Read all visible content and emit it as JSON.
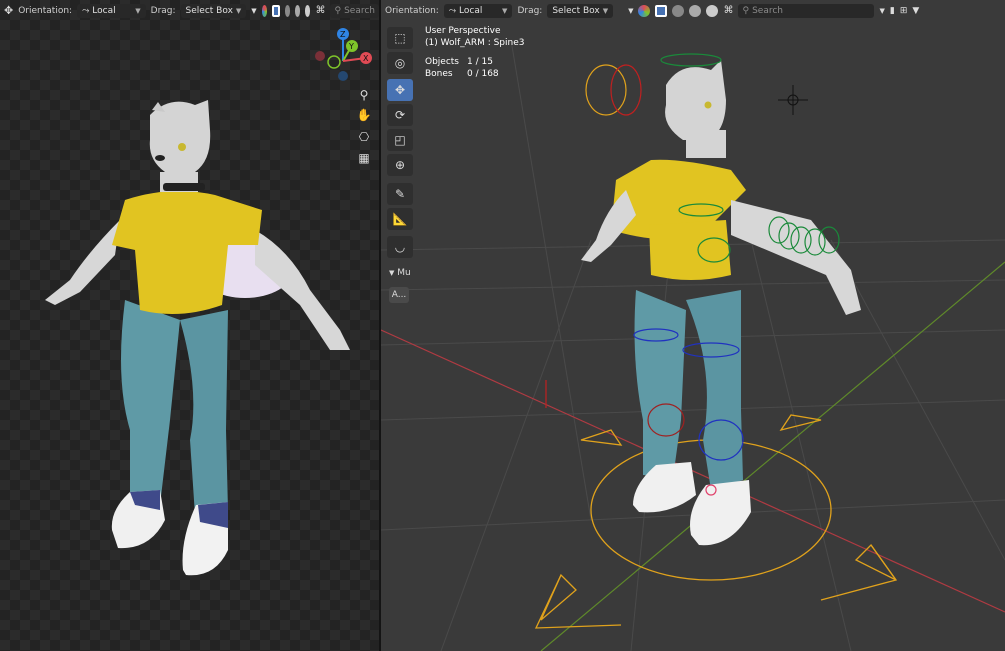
{
  "left_header": {
    "orientation_label": "Orientation:",
    "orientation_value": "Local",
    "drag_label": "Drag:",
    "drag_value": "Select Box",
    "search_placeholder": "Search"
  },
  "right_header": {
    "orientation_label": "Orientation:",
    "orientation_value": "Local",
    "drag_label": "Drag:",
    "drag_value": "Select Box",
    "search_placeholder": "Search"
  },
  "gizmo": {
    "z": "Z",
    "y": "Y",
    "x": "X"
  },
  "overlay": {
    "view_name": "User Perspective",
    "active_object": "(1) Wolf_ARM : Spine3",
    "objects_label": "Objects",
    "objects_value": "1 / 15",
    "bones_label": "Bones",
    "bones_value": "0 / 168"
  },
  "toolbar": {
    "tools": [
      "select-box",
      "cursor",
      "move",
      "rotate",
      "scale",
      "transform",
      "annotate",
      "measure",
      "bone-envelope"
    ],
    "active_tool": "move"
  },
  "last_operator": {
    "label": "Mu",
    "button": "A..."
  },
  "colors": {
    "accent": "#4772b3",
    "shirt": "#e1c421",
    "jeans": "#5f9aa6",
    "fur": "#d4d4d4",
    "gizmo_x": "#e14b55",
    "gizmo_y": "#7ec42a",
    "gizmo_z": "#2f85e6",
    "root_bone": "#e0a21c"
  }
}
